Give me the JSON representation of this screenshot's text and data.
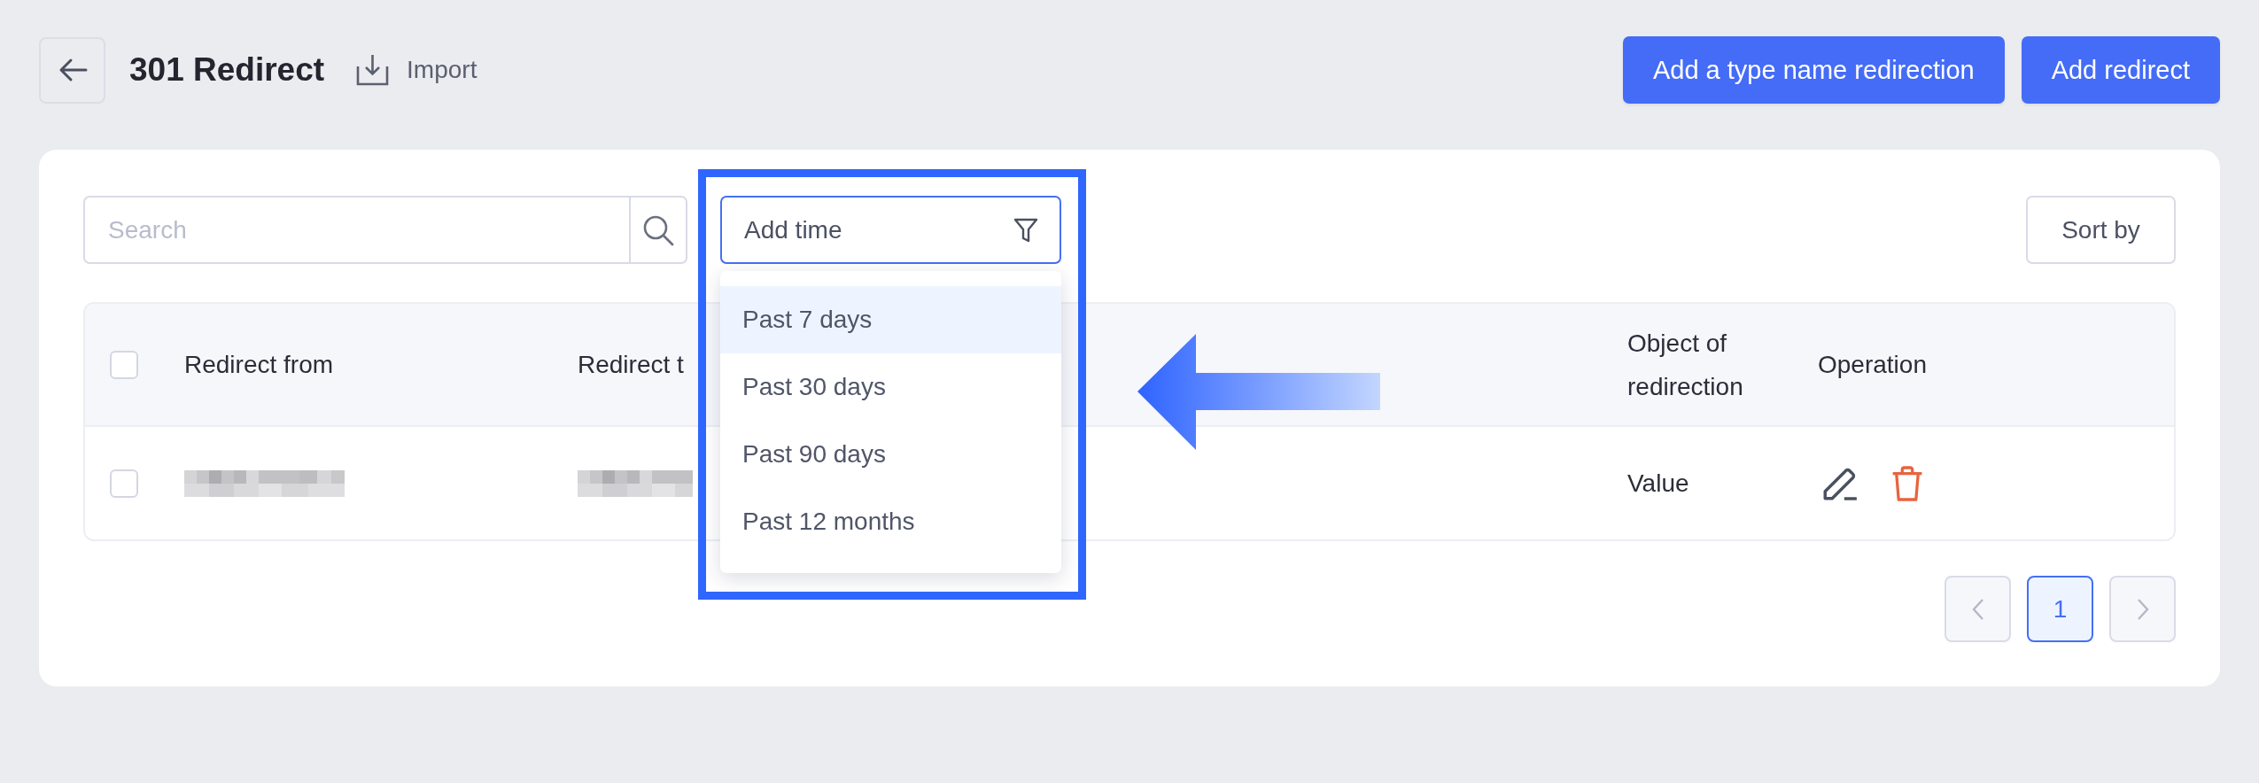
{
  "header": {
    "title": "301 Redirect",
    "import_label": "Import",
    "actions": [
      "Add a type name redirection",
      "Add redirect"
    ]
  },
  "toolbar": {
    "search": {
      "placeholder": "Search"
    },
    "time_filter": {
      "label": "Add time",
      "expanded": true,
      "options": [
        {
          "label": "Past 7 days",
          "selected": true
        },
        {
          "label": "Past 30 days",
          "selected": false
        },
        {
          "label": "Past 90 days",
          "selected": false
        },
        {
          "label": "Past 12 months",
          "selected": false
        }
      ]
    },
    "sort_label": "Sort by"
  },
  "table": {
    "select_all": {
      "checked": false
    },
    "columns": [
      "Redirect from",
      "Redirect t",
      "Object of redirection",
      "Operation"
    ],
    "rows": [
      {
        "checked": false,
        "cells": [
          {
            "kind": "redacted"
          },
          {
            "kind": "redacted"
          },
          {
            "kind": "text",
            "text": "Value"
          },
          {
            "kind": "actions"
          }
        ]
      }
    ]
  },
  "pagination": {
    "prev_disabled": true,
    "pages": [
      {
        "label": "1",
        "selected": true
      }
    ],
    "next_disabled": true
  }
}
